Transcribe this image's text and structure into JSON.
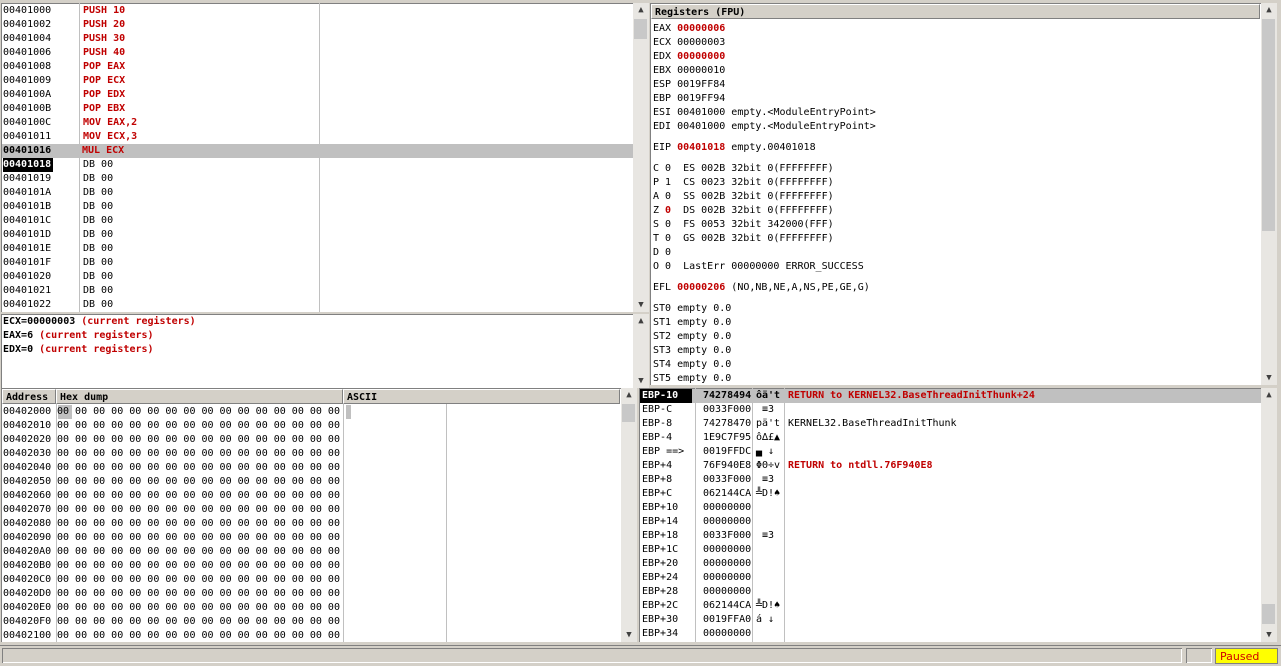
{
  "disasm": {
    "rows": [
      {
        "addr": "00401000",
        "code": "PUSH 10",
        "hl": true
      },
      {
        "addr": "00401002",
        "code": "PUSH 20",
        "hl": true
      },
      {
        "addr": "00401004",
        "code": "PUSH 30",
        "hl": true
      },
      {
        "addr": "00401006",
        "code": "PUSH 40",
        "hl": true
      },
      {
        "addr": "00401008",
        "code": "POP EAX",
        "hl": true
      },
      {
        "addr": "00401009",
        "code": "POP ECX",
        "hl": true
      },
      {
        "addr": "0040100A",
        "code": "POP EDX",
        "hl": true
      },
      {
        "addr": "0040100B",
        "code": "POP EBX",
        "hl": true
      },
      {
        "addr": "0040100C",
        "code": "MOV EAX,2",
        "hl": true
      },
      {
        "addr": "00401011",
        "code": "MOV ECX,3",
        "hl": true
      },
      {
        "addr": "00401016",
        "code": "MUL ECX",
        "hl": true,
        "selected": true
      },
      {
        "addr": "00401018",
        "code": "DB 00",
        "eip": true
      },
      {
        "addr": "00401019",
        "code": "DB 00"
      },
      {
        "addr": "0040101A",
        "code": "DB 00"
      },
      {
        "addr": "0040101B",
        "code": "DB 00"
      },
      {
        "addr": "0040101C",
        "code": "DB 00"
      },
      {
        "addr": "0040101D",
        "code": "DB 00"
      },
      {
        "addr": "0040101E",
        "code": "DB 00"
      },
      {
        "addr": "0040101F",
        "code": "DB 00"
      },
      {
        "addr": "00401020",
        "code": "DB 00"
      },
      {
        "addr": "00401021",
        "code": "DB 00"
      },
      {
        "addr": "00401022",
        "code": "DB 00"
      }
    ]
  },
  "info": {
    "rows": [
      {
        "a": "ECX=00000003",
        "b": " (current registers)"
      },
      {
        "a": "EAX=6",
        "b": " (current registers)"
      },
      {
        "a": "EDX=0",
        "b": " (current registers)"
      }
    ]
  },
  "registers": {
    "title": "Registers (FPU)",
    "rows": [
      {
        "n": "EAX",
        "v": "00000006",
        "c": "",
        "red": true
      },
      {
        "n": "ECX",
        "v": "00000003",
        "c": ""
      },
      {
        "n": "EDX",
        "v": "00000000",
        "c": "",
        "red": true
      },
      {
        "n": "EBX",
        "v": "00000010",
        "c": ""
      },
      {
        "n": "ESP",
        "v": "0019FF84",
        "c": ""
      },
      {
        "n": "EBP",
        "v": "0019FF94",
        "c": ""
      },
      {
        "n": "ESI",
        "v": "00401000",
        "c": "empty.<ModuleEntryPoint>"
      },
      {
        "n": "EDI",
        "v": "00401000",
        "c": "empty.<ModuleEntryPoint>"
      },
      {
        "gap": true
      },
      {
        "n": "EIP",
        "v": "00401018",
        "c": "empty.00401018",
        "red": true
      },
      {
        "gap": true
      },
      {
        "t": "C 0  ES 002B 32bit 0(FFFFFFFF)"
      },
      {
        "t": "P 1  CS 0023 32bit 0(FFFFFFFF)"
      },
      {
        "t": "A 0  SS 002B 32bit 0(FFFFFFFF)"
      },
      {
        "t1": "Z ",
        "tr": "0",
        "t2": "  DS 002B 32bit 0(FFFFFFFF)"
      },
      {
        "t": "S 0  FS 0053 32bit 342000(FFF)"
      },
      {
        "t": "T 0  GS 002B 32bit 0(FFFFFFFF)"
      },
      {
        "t": "D 0"
      },
      {
        "t": "O 0  LastErr 00000000 ERROR_SUCCESS"
      },
      {
        "gap": true
      },
      {
        "n": "EFL",
        "v": "00000206",
        "c": "(NO,NB,NE,A,NS,PE,GE,G)",
        "red": true
      },
      {
        "gap": true
      },
      {
        "t": "ST0 empty 0.0"
      },
      {
        "t": "ST1 empty 0.0"
      },
      {
        "t": "ST2 empty 0.0"
      },
      {
        "t": "ST3 empty 0.0"
      },
      {
        "t": "ST4 empty 0.0"
      },
      {
        "t": "ST5 empty 0.0"
      }
    ]
  },
  "dump": {
    "headers": {
      "address": "Address",
      "hex": "Hex dump",
      "ascii": "ASCII"
    },
    "bytes": "00 00 00 00 00 00 00 00 00 00 00 00 00 00 00 00",
    "addresses": [
      "00402000",
      "00402010",
      "00402020",
      "00402030",
      "00402040",
      "00402050",
      "00402060",
      "00402070",
      "00402080",
      "00402090",
      "004020A0",
      "004020B0",
      "004020C0",
      "004020D0",
      "004020E0",
      "004020F0",
      "00402100"
    ]
  },
  "stack": {
    "rows": [
      {
        "off": "EBP-10",
        "val": "74278494",
        "asc": "ôä't",
        "cmt": "RETURN to KERNEL32.BaseThreadInitThunk+24",
        "sel": true,
        "red": true
      },
      {
        "off": "EBP-C",
        "val": "0033F000",
        "asc": " ≡3",
        "cmt": ""
      },
      {
        "off": "EBP-8",
        "val": "74278470",
        "asc": "pä't",
        "cmt": "KERNEL32.BaseThreadInitThunk"
      },
      {
        "off": "EBP-4",
        "val": "1E9C7F95",
        "asc": "ô∆£▲",
        "cmt": ""
      },
      {
        "off": "EBP ==>",
        "val": "0019FFDC",
        "asc": "▄ ↓",
        "cmt": ""
      },
      {
        "off": "EBP+4",
        "val": "76F940E8",
        "asc": "ΦΘ÷v",
        "cmt": "RETURN to ntdll.76F940E8",
        "red": true
      },
      {
        "off": "EBP+8",
        "val": "0033F000",
        "asc": " ≡3",
        "cmt": ""
      },
      {
        "off": "EBP+C",
        "val": "062144CA",
        "asc": "╩D!♠",
        "cmt": ""
      },
      {
        "off": "EBP+10",
        "val": "00000000",
        "asc": "",
        "cmt": ""
      },
      {
        "off": "EBP+14",
        "val": "00000000",
        "asc": "",
        "cmt": ""
      },
      {
        "off": "EBP+18",
        "val": "0033F000",
        "asc": " ≡3",
        "cmt": ""
      },
      {
        "off": "EBP+1C",
        "val": "00000000",
        "asc": "",
        "cmt": ""
      },
      {
        "off": "EBP+20",
        "val": "00000000",
        "asc": "",
        "cmt": ""
      },
      {
        "off": "EBP+24",
        "val": "00000000",
        "asc": "",
        "cmt": ""
      },
      {
        "off": "EBP+28",
        "val": "00000000",
        "asc": "",
        "cmt": ""
      },
      {
        "off": "EBP+2C",
        "val": "062144CA",
        "asc": "╩D!♠",
        "cmt": ""
      },
      {
        "off": "EBP+30",
        "val": "0019FFA0",
        "asc": "á ↓",
        "cmt": ""
      },
      {
        "off": "EBP+34",
        "val": "00000000",
        "asc": "",
        "cmt": ""
      }
    ]
  },
  "status": {
    "state": "Paused"
  },
  "colors": {
    "accent_red": "#c00000",
    "status_yellow": "#ffff00",
    "selection": "#c0c0c0"
  }
}
